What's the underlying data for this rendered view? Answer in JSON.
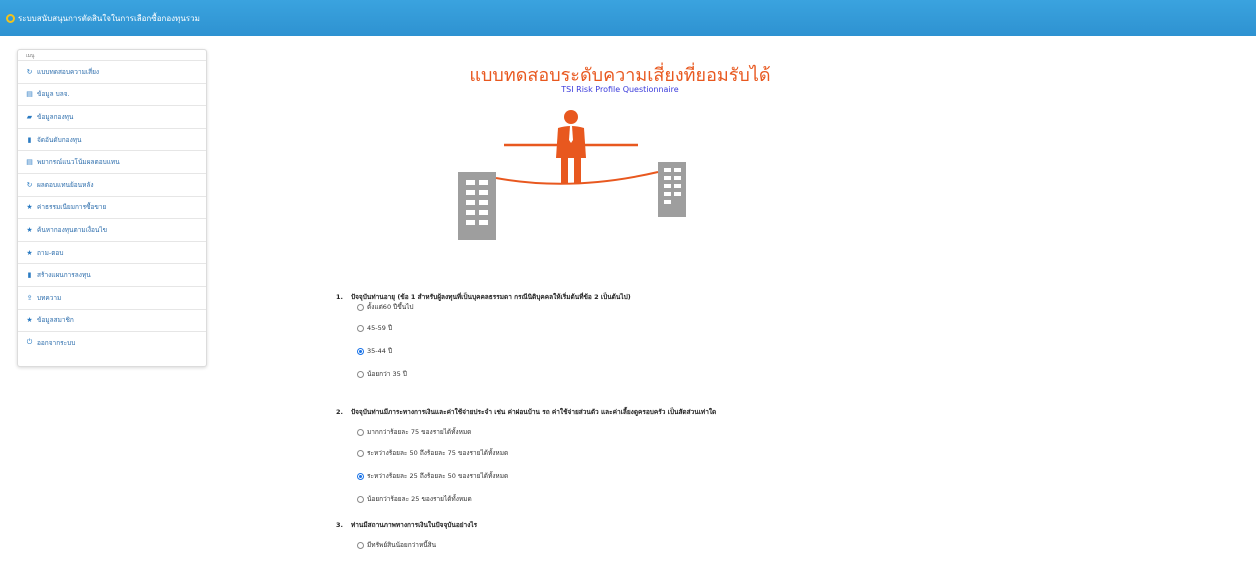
{
  "app": {
    "title": "ระบบสนับสนุนการตัดสินใจในการเลือกซื้อกองทุนรวม",
    "accent": "#2e92d1"
  },
  "sidebar": {
    "caption": "เมนู",
    "items": [
      {
        "label": "แบบทดสอบความเสี่ยง",
        "icon": "↻",
        "icon_name": "refresh-icon"
      },
      {
        "label": "ข้อมูล บลจ.",
        "icon": "▤",
        "icon_name": "list-icon"
      },
      {
        "label": "ข้อมูลกองทุน",
        "icon": "▰",
        "icon_name": "folder-icon"
      },
      {
        "label": "จัดอันดับกองทุน",
        "icon": "▮",
        "icon_name": "bar-chart-icon"
      },
      {
        "label": "พยากรณ์แนวโน้มผลตอบแทน",
        "icon": "▤",
        "icon_name": "list-icon"
      },
      {
        "label": "ผลตอบแทนย้อนหลัง",
        "icon": "↻",
        "icon_name": "refresh-icon"
      },
      {
        "label": "ค่าธรรมเนียมการซื้อขาย",
        "icon": "★",
        "icon_name": "star-icon"
      },
      {
        "label": "ค้นหากองทุนตามเงื่อนไข",
        "icon": "★",
        "icon_name": "star-icon"
      },
      {
        "label": "ถาม-ตอบ",
        "icon": "★",
        "icon_name": "star-icon"
      },
      {
        "label": "สร้างแผนการลงทุน",
        "icon": "▮",
        "icon_name": "bar-chart-icon"
      },
      {
        "label": "บทความ",
        "icon": "⇪",
        "icon_name": "upload-icon"
      },
      {
        "label": "ข้อมูลสมาชิก",
        "icon": "★",
        "icon_name": "star-icon"
      },
      {
        "label": "ออกจากระบบ",
        "icon": "⏻",
        "icon_name": "power-icon"
      }
    ]
  },
  "main": {
    "title": "แบบทดสอบระดับความเสี่ยงที่ยอมรับได้",
    "subtitle": "TSI Risk Profile Questionnaire",
    "title_color": "#e8581f",
    "subtitle_color": "#3a3adb"
  },
  "questions": [
    {
      "num": "1.",
      "text": "ปัจจุบันท่านอายุ (ข้อ 1 สำหรับผู้ลงทุนที่เป็นบุคคลธรรมดา กรณีนิติบุคคลให้เริ่มต้นที่ข้อ 2 เป็นต้นไป)",
      "options": [
        {
          "label": "ตั้งแต่60 ปีขึ้นไป",
          "checked": false
        },
        {
          "label": "45-59 ปี",
          "checked": false
        },
        {
          "label": "35-44 ปี",
          "checked": true
        },
        {
          "label": "น้อยกว่า 35 ปี",
          "checked": false
        }
      ]
    },
    {
      "num": "2.",
      "text": "ปัจจุบันท่านมีภาระทางการเงินและค่าใช้จ่ายประจำ เช่น ค่าผ่อนบ้าน รถ ค่าใช้จ่ายส่วนตัว และค่าเลี้ยงดูครอบครัว เป็นสัดส่วนเท่าใด",
      "options": [
        {
          "label": "มากกว่าร้อยละ 75 ของรายได้ทั้งหมด",
          "checked": false
        },
        {
          "label": "ระหว่างร้อยละ 50 ถึงร้อยละ 75 ของรายได้ทั้งหมด",
          "checked": false
        },
        {
          "label": "ระหว่างร้อยละ 25 ถึงร้อยละ 50 ของรายได้ทั้งหมด",
          "checked": true
        },
        {
          "label": "น้อยกว่าร้อยละ 25 ของรายได้ทั้งหมด",
          "checked": false
        }
      ]
    },
    {
      "num": "3.",
      "text": "ท่านมีสถานภาพทางการเงินในปัจจุบันอย่างไร",
      "options": [
        {
          "label": "มีทรัพย์สินน้อยกว่าหนี้สิน",
          "checked": false
        }
      ]
    }
  ]
}
